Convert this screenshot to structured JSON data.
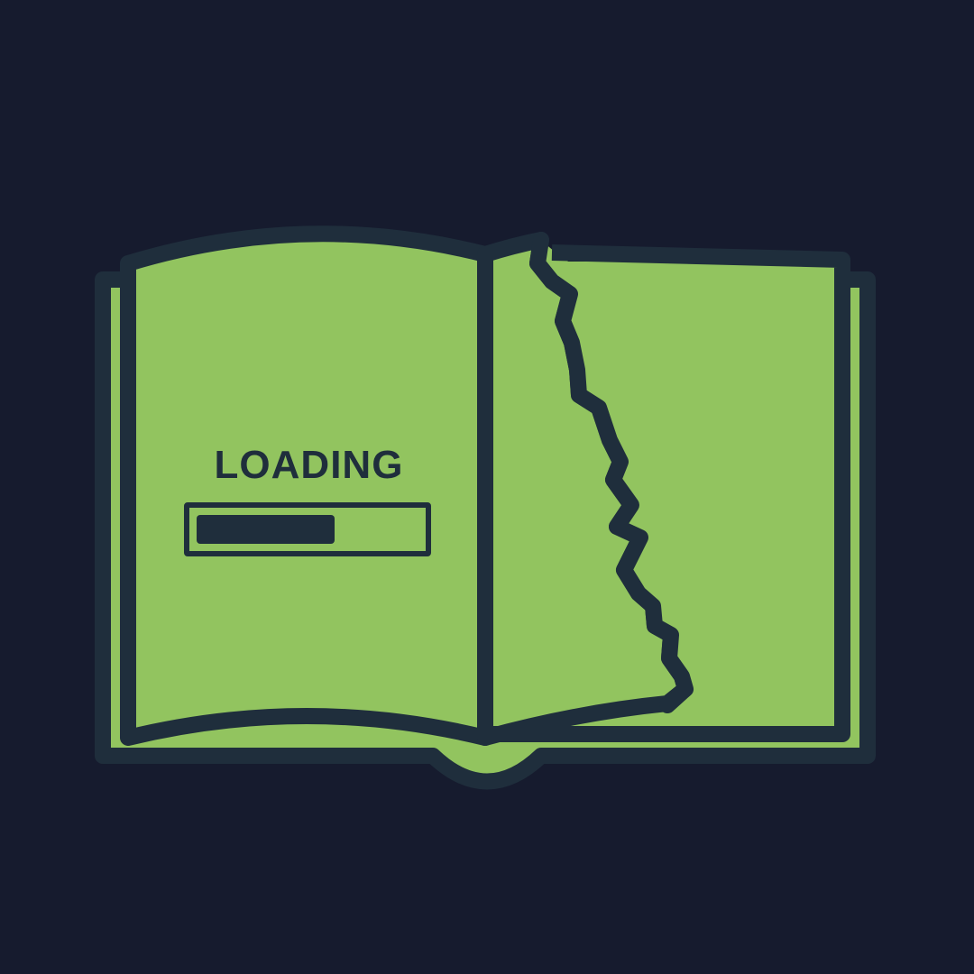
{
  "loading": {
    "label": "LOADING",
    "progress": 0.62
  },
  "colors": {
    "background": "#161b2e",
    "page": "#92c45f",
    "outline": "#1f2e3c"
  },
  "icons": {
    "book": "open-book-icon",
    "tear": "torn-page-edge"
  }
}
